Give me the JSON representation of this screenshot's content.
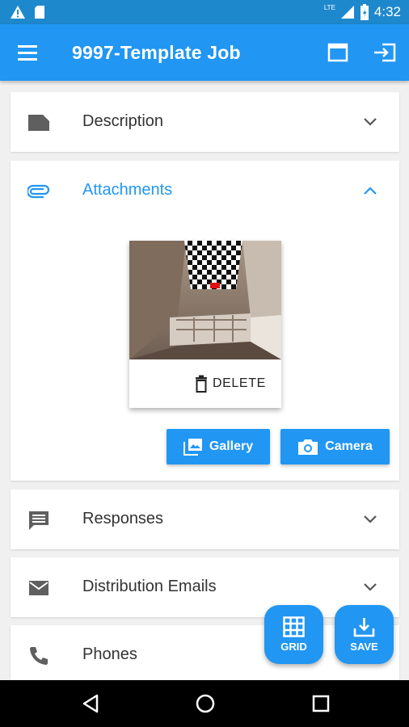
{
  "status_bar": {
    "time": "4:32",
    "network_label": "LTE"
  },
  "app_bar": {
    "title": "9997-Template Job"
  },
  "sections": {
    "description": "Description",
    "attachments": "Attachments",
    "responses": "Responses",
    "distribution_emails": "Distribution Emails",
    "phones": "Phones"
  },
  "attachment": {
    "delete_label": "DELETE"
  },
  "buttons": {
    "gallery": "Gallery",
    "camera": "Camera"
  },
  "fabs": {
    "grid": "GRID",
    "save": "SAVE"
  },
  "colors": {
    "primary": "#2196f3",
    "status_bar": "#1e88cc",
    "accent_text": "#2196f3"
  }
}
